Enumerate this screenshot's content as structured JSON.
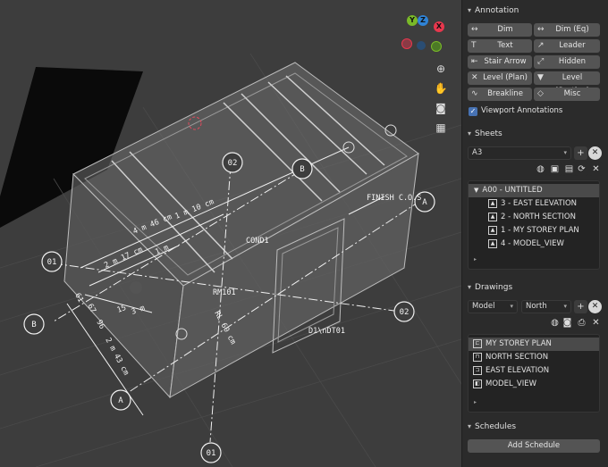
{
  "viewport": {
    "labels": {
      "cond": "COND1",
      "room": "RM101",
      "door": "D1\\nDT01",
      "finish": "FINISH C.O.S",
      "dim_4m46": "4 m 46 cm",
      "dim_1m10": "1 m 10 cm",
      "dim_2m17": "2 m 17 cm",
      "dim_1m": "1 m",
      "dim_2m43": "2 m 43 cm",
      "dim_15": "15",
      "dim_3m": "3 m",
      "dim_96": "96",
      "dim_67": "67",
      "dim_61": "61",
      "dim_rl": "RL 60 cm"
    },
    "bubbles": {
      "b01_left": "01",
      "b01_bottom": "01",
      "b02_top": "02",
      "b02_right": "02",
      "bA_right": "A",
      "bA_bottom": "A",
      "bB_top": "B",
      "bB_left": "B"
    },
    "gizmo": {
      "y": "Y",
      "z": "Z",
      "x": "X"
    },
    "nav_icons": [
      "zoom-icon",
      "hand-icon",
      "camera-icon",
      "grid-icon"
    ]
  },
  "sidebar": {
    "annotation": {
      "title": "Annotation",
      "buttons": [
        {
          "label": "Dim",
          "icon": "↔"
        },
        {
          "label": "Dim (Eq)",
          "icon": "↔"
        },
        {
          "label": "Text",
          "icon": "T"
        },
        {
          "label": "Leader",
          "icon": "↗"
        },
        {
          "label": "Stair Arrow",
          "icon": "⇤"
        },
        {
          "label": "Hidden",
          "icon": "⤢"
        },
        {
          "label": "Level (Plan)",
          "icon": "✕"
        },
        {
          "label": "Level (Section)",
          "icon": "▼"
        },
        {
          "label": "Breakline",
          "icon": "∿"
        },
        {
          "label": "Misc",
          "icon": "◇"
        }
      ],
      "viewport_annotations": "Viewport Annotations"
    },
    "sheets": {
      "title": "Sheets",
      "selected": "A3",
      "items": [
        {
          "label": "A00 - UNTITLED",
          "level": 0
        },
        {
          "label": "3 - EAST ELEVATION",
          "level": 1
        },
        {
          "label": "2 - NORTH SECTION",
          "level": 1
        },
        {
          "label": "1 - MY STOREY PLAN",
          "level": 1
        },
        {
          "label": "4 - MODEL_VIEW",
          "level": 1
        }
      ]
    },
    "drawings": {
      "title": "Drawings",
      "type": "Model",
      "direction": "North",
      "items": [
        {
          "label": "MY STOREY PLAN"
        },
        {
          "label": "NORTH SECTION"
        },
        {
          "label": "EAST ELEVATION"
        },
        {
          "label": "MODEL_VIEW"
        }
      ]
    },
    "schedules": {
      "title": "Schedules",
      "add_label": "Add Schedule"
    }
  },
  "colors": {
    "accent": "#4772b3",
    "gizmo_x": "#e8374d",
    "gizmo_y": "#7ab928",
    "gizmo_z": "#2f83d6"
  }
}
